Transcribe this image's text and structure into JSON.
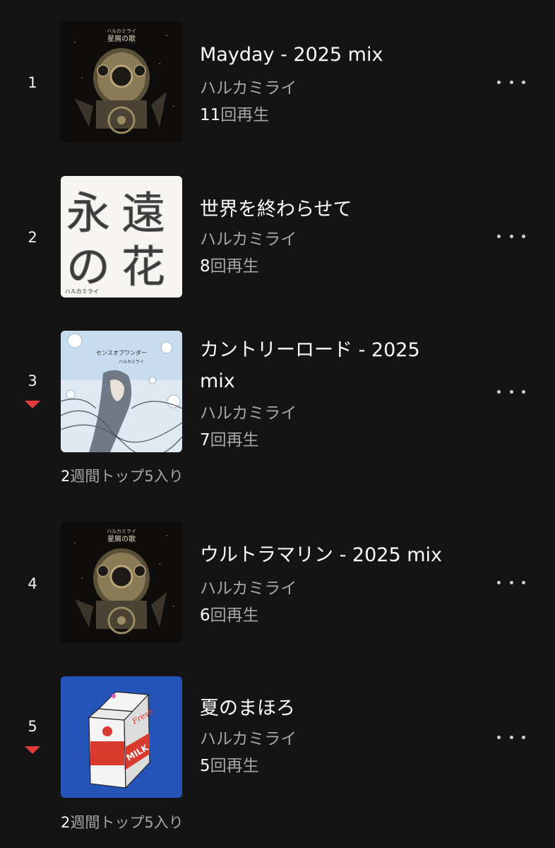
{
  "chart": {
    "tracks": [
      {
        "rank": "1",
        "title": "Mayday - 2025 mix",
        "artist": "ハルカミライ",
        "plays_num": "11",
        "plays_suffix": "回再生",
        "cover": {
          "type": "diving-helmet",
          "caption_artist": "ハルカミライ",
          "caption_album": "星屑の歌"
        }
      },
      {
        "rank": "2",
        "title": "世界を終わらせて",
        "artist": "ハルカミライ",
        "plays_num": "8",
        "plays_suffix": "回再生",
        "cover": {
          "type": "calligraphy",
          "glyphs": [
            "永",
            "遠",
            "の",
            "花"
          ],
          "caption_artist": "ハルカミライ"
        }
      },
      {
        "rank": "3",
        "title_line1": "カントリーロード - 2025",
        "title_line2": "mix",
        "artist": "ハルカミライ",
        "plays_num": "7",
        "plays_suffix": "回再生",
        "trend": "down",
        "weeks_num": "2",
        "weeks_text": "週間トップ5入り",
        "cover": {
          "type": "illustration",
          "caption_album": "センスオブワンダー",
          "caption_artist": "ハルカミライ"
        }
      },
      {
        "rank": "4",
        "title": "ウルトラマリン - 2025 mix",
        "artist": "ハルカミライ",
        "plays_num": "6",
        "plays_suffix": "回再生",
        "cover": {
          "type": "diving-helmet",
          "caption_artist": "ハルカミライ",
          "caption_album": "星屑の歌"
        }
      },
      {
        "rank": "5",
        "title": "夏のまほろ",
        "artist": "ハルカミライ",
        "plays_num": "5",
        "plays_suffix": "回再生",
        "trend": "down",
        "weeks_num": "2",
        "weeks_text": "週間トップ5入り",
        "cover": {
          "type": "milk-carton",
          "carton_word": "Fresh",
          "carton_brand": "MILK"
        }
      }
    ],
    "more_icon": "more-horizontal-icon",
    "trend_icon": "trend-down-icon",
    "colors": {
      "background": "#141414",
      "trend_down": "#e33c3c",
      "secondary_text": "#a6a6a6",
      "milk_blue": "#2454b8"
    }
  }
}
